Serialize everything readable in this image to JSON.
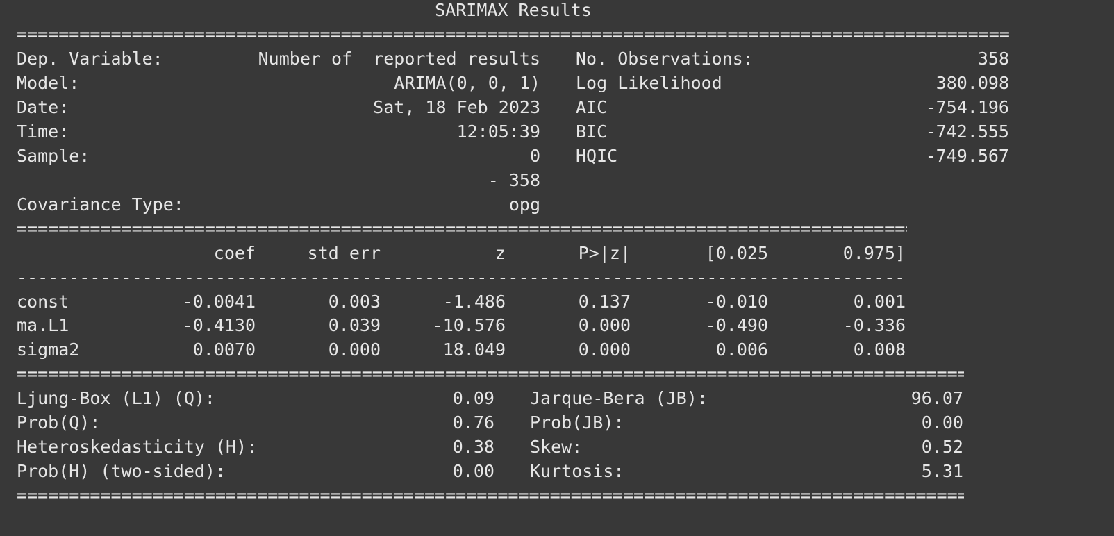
{
  "title": "SARIMAX Results",
  "model_info": {
    "rows": [
      {
        "label": "Dep. Variable:",
        "value": "Number of  reported results",
        "label2": "No. Observations:",
        "value2": "358"
      },
      {
        "label": "Model:",
        "value": "ARIMA(0, 0, 1)",
        "label2": "Log Likelihood",
        "value2": "380.098"
      },
      {
        "label": "Date:",
        "value": "Sat, 18 Feb 2023",
        "label2": "AIC",
        "value2": "-754.196"
      },
      {
        "label": "Time:",
        "value": "12:05:39",
        "label2": "BIC",
        "value2": "-742.555"
      },
      {
        "label": "Sample:",
        "value": "0",
        "label2": "HQIC",
        "value2": "-749.567"
      },
      {
        "label": "",
        "value": "- 358",
        "label2": "",
        "value2": ""
      },
      {
        "label": "Covariance Type:",
        "value": "opg",
        "label2": "",
        "value2": ""
      }
    ]
  },
  "coef_table": {
    "headers": [
      "",
      "coef",
      "std err",
      "z",
      "P>|z|",
      "[0.025",
      "0.975]"
    ],
    "rows": [
      [
        "const",
        "-0.0041",
        "0.003",
        "-1.486",
        "0.137",
        "-0.010",
        "0.001"
      ],
      [
        "ma.L1",
        "-0.4130",
        "0.039",
        "-10.576",
        "0.000",
        "-0.490",
        "-0.336"
      ],
      [
        "sigma2",
        "0.0070",
        "0.000",
        "18.049",
        "0.000",
        "0.006",
        "0.008"
      ]
    ]
  },
  "diagnostics": {
    "rows": [
      {
        "label": "Ljung-Box (L1) (Q):",
        "value": "0.09",
        "label2": "Jarque-Bera (JB):",
        "value2": "96.07"
      },
      {
        "label": "Prob(Q):",
        "value": "0.76",
        "label2": "Prob(JB):",
        "value2": "0.00"
      },
      {
        "label": "Heteroskedasticity (H):",
        "value": "0.38",
        "label2": "Skew:",
        "value2": "0.52"
      },
      {
        "label": "Prob(H) (two-sided):",
        "value": "0.00",
        "label2": "Kurtosis:",
        "value2": "5.31"
      }
    ]
  }
}
